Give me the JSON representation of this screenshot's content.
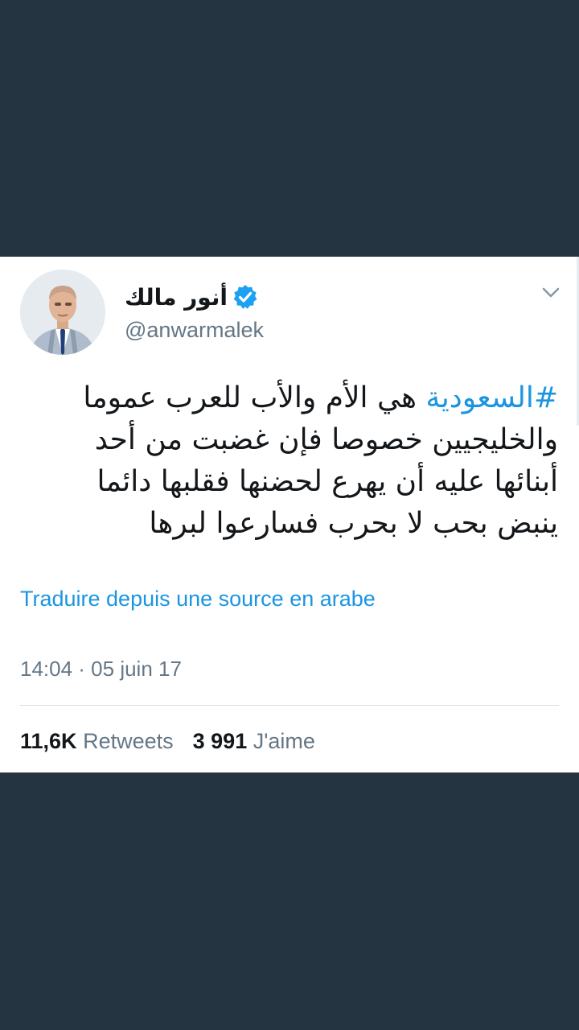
{
  "tweet": {
    "display_name": "أنور مالك",
    "verified": true,
    "handle": "@anwarmalek",
    "hashtag": "#السعودية",
    "text_line1_rest": " هي الأم والأب للعرب عموما",
    "text_line2": "والخليجيين خصوصا فإن غضبت من أحد",
    "text_line3": "أبنائها عليه أن يهرع لحضنها فقلبها دائما",
    "text_line4": "ينبض بحب لا بحرب فسارعوا لبرها",
    "translate_label": "Traduire depuis une source en arabe",
    "timestamp": "14:04 · 05 juin 17",
    "retweets_count": "11,6K",
    "retweets_label": "Retweets",
    "likes_count": "3 991",
    "likes_label": "J'aime"
  },
  "icons": {
    "verified": "verified-badge-icon",
    "menu": "chevron-down-icon"
  },
  "colors": {
    "background": "#243441",
    "link": "#1b95e0",
    "verified": "#1da1f2",
    "text": "#14171a",
    "secondary": "#657786"
  }
}
